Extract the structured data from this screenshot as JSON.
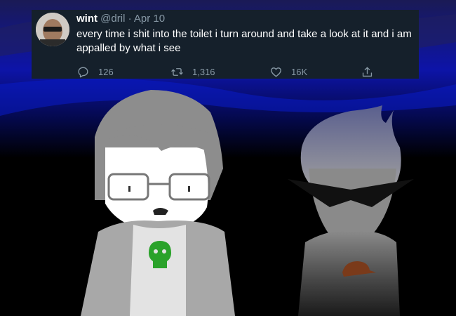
{
  "tweet": {
    "author_name": "wint",
    "handle": "@dril",
    "separator": "·",
    "date": "Apr 10",
    "text": "every time i shit into the toilet i turn around and take a look at it and i am appalled by what i see",
    "replies": "126",
    "retweets": "1,316",
    "likes": "16K"
  },
  "icons": {
    "reply": "reply-icon",
    "retweet": "retweet-icon",
    "like": "like-icon",
    "share": "share-icon"
  },
  "colors": {
    "tweet_background": "#15202b",
    "text_primary": "#ffffff",
    "text_secondary": "#8899a6",
    "sky_blue": "#0a14a0",
    "skull_green": "#2aa22a",
    "cap_brown": "#7a3a1a"
  }
}
